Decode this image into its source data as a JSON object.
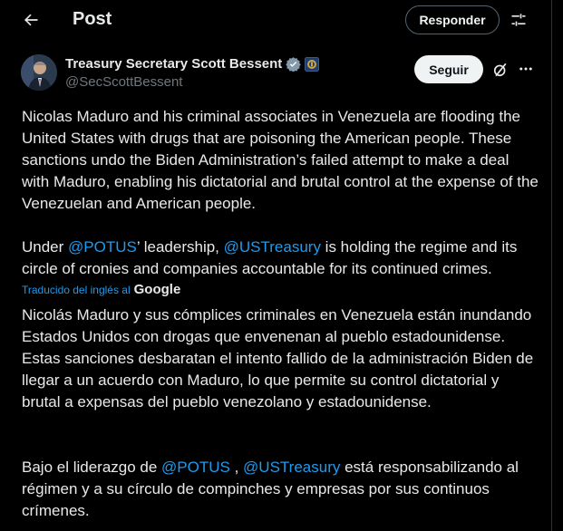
{
  "header": {
    "title": "Post",
    "reply_label": "Responder"
  },
  "author": {
    "name": "Treasury Secretary Scott Bessent",
    "handle": "@SecScottBessent",
    "follow_label": "Seguir"
  },
  "tweet": {
    "original_p1": "Nicolas Maduro and his criminal associates in Venezuela are flooding the United States with drugs that are poisoning the American people. These sanctions undo the Biden Administration’s failed attempt to make a deal with Maduro, enabling his dictatorial and brutal control at the expense of the Venezuelan and American people.",
    "original_p2": {
      "prefix": "Under ",
      "mention1": "@POTUS",
      "middle": "’ leadership, ",
      "mention2": "@USTreasury",
      "suffix": " is holding the regime and its circle of cronies and companies accountable for its continued crimes."
    },
    "translated_label": "Traducido del inglés al",
    "translated_provider": "Google",
    "translation_p1": "Nicolás Maduro y sus cómplices criminales en Venezuela están inundando Estados Unidos con drogas que envenenan al pueblo estadounidense. Estas sanciones desbaratan el intento fallido de la administración Biden de llegar a un acuerdo con Maduro, lo que permite su control dictatorial y brutal a expensas del pueblo venezolano y estadounidense.",
    "translation_p2": {
      "prefix": "Bajo el liderazgo de ",
      "mention1": "@POTUS",
      "middle": " , ",
      "mention2": "@USTreasury",
      "suffix": " está responsabilizando al régimen y a su círculo de compinches y empresas por sus continuos crímenes."
    }
  },
  "colors": {
    "accent": "#1d9bf0",
    "background": "#000000",
    "text": "#e7e9ea",
    "muted": "#71767b",
    "verified": "#829aab"
  },
  "icons": [
    "back-arrow-icon",
    "sliders-icon",
    "verified-badge-icon",
    "treasury-seal-icon",
    "grok-icon",
    "more-icon"
  ]
}
